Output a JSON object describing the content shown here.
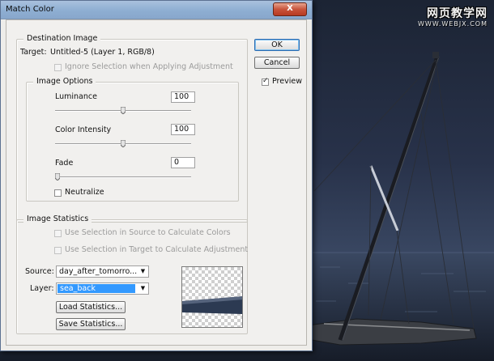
{
  "window": {
    "title": "Match Color",
    "close_label": "X"
  },
  "watermark": {
    "line1": "网页教学网",
    "line2": "WWW.WEBJX.COM"
  },
  "destination": {
    "legend": "Destination Image",
    "target_label": "Target:",
    "target_value": "Untitled-5 (Layer 1, RGB/8)",
    "ignore_selection_label": "Ignore Selection when Applying Adjustment"
  },
  "image_options": {
    "legend": "Image Options",
    "luminance": {
      "label": "Luminance",
      "value": "100",
      "level": 100,
      "max": 200
    },
    "color_intensity": {
      "label": "Color Intensity",
      "value": "100",
      "level": 100,
      "max": 200
    },
    "fade": {
      "label": "Fade",
      "value": "0",
      "level": 0,
      "max": 100
    },
    "neutralize_label": "Neutralize"
  },
  "image_statistics": {
    "legend": "Image Statistics",
    "use_selection_source_label": "Use Selection in Source to Calculate Colors",
    "use_selection_target_label": "Use Selection in Target to Calculate Adjustment",
    "source_label": "Source:",
    "source_value": "day_after_tomorro...",
    "layer_label": "Layer:",
    "layer_value": "sea_back",
    "load_button": "Load Statistics...",
    "save_button": "Save Statistics..."
  },
  "buttons": {
    "ok": "OK",
    "cancel": "Cancel",
    "preview_label": "Preview",
    "preview_checked": true
  },
  "colors": {
    "accent": "#3399ff",
    "title_bar": "#8eaed2",
    "close": "#c8533b",
    "sky": "#2a3346"
  }
}
